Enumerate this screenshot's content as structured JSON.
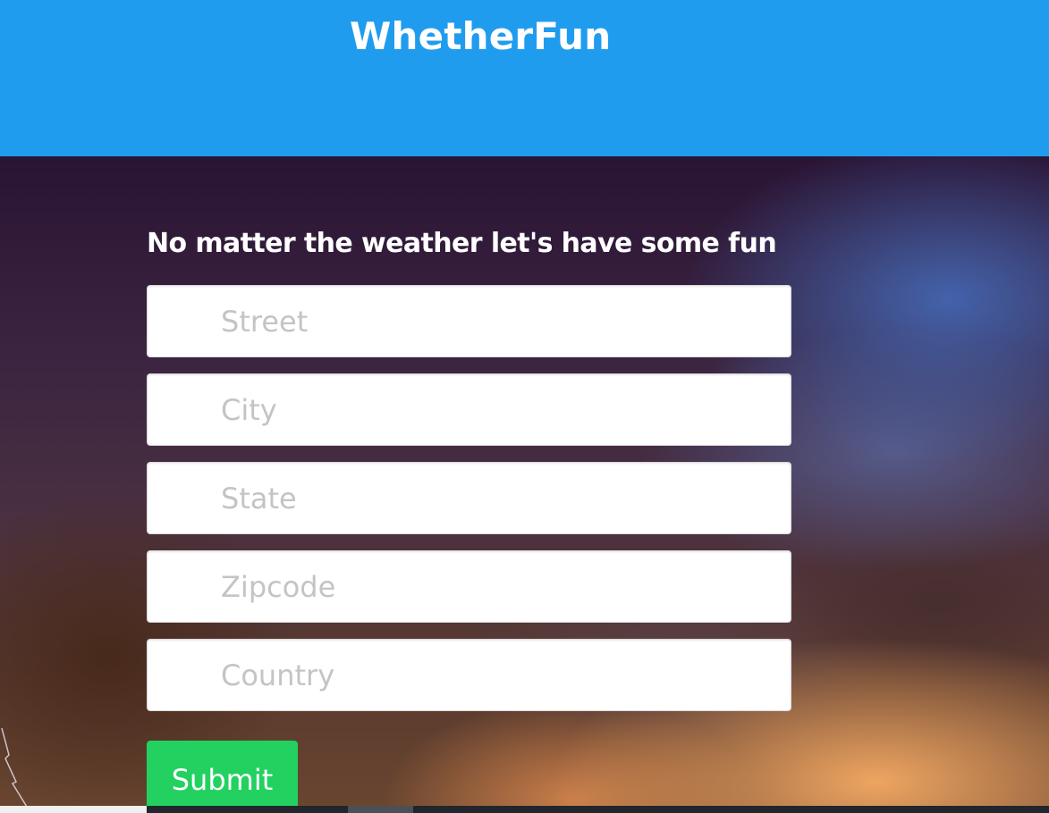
{
  "header": {
    "brand": "WhetherFun",
    "background_color": "#209cee"
  },
  "hero": {
    "tagline": "No matter the weather let's have some fun"
  },
  "form": {
    "fields": [
      {
        "placeholder": "Street",
        "value": ""
      },
      {
        "placeholder": "City",
        "value": ""
      },
      {
        "placeholder": "State",
        "value": ""
      },
      {
        "placeholder": "Zipcode",
        "value": ""
      },
      {
        "placeholder": "Country",
        "value": ""
      }
    ],
    "submit_label": "Submit",
    "submit_color": "#23d160"
  }
}
